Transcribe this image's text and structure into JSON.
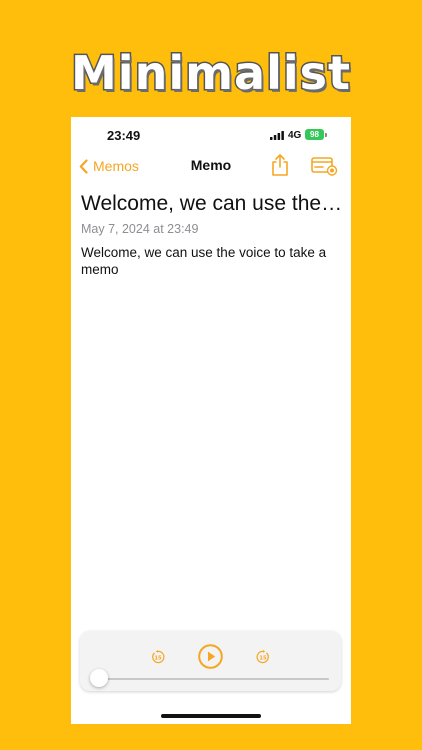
{
  "promo": {
    "title": "Minimalist"
  },
  "status_bar": {
    "time": "23:49",
    "network": "4G",
    "battery": "98",
    "battery_color": "#34C759"
  },
  "nav": {
    "back_label": "Memos",
    "title": "Memo",
    "accent_color": "#F5A623",
    "icons": [
      "chevron-left-icon",
      "share-icon",
      "reader-mode-icon"
    ]
  },
  "memo": {
    "title": "Welcome, we can use the voice to take a memo",
    "date": "May 7, 2024 at 23:49",
    "body": "Welcome, we can use the voice to take a memo"
  },
  "player": {
    "skip_back_seconds": "15",
    "skip_forward_seconds": "15",
    "progress": 0,
    "icons": [
      "skip-back-15-icon",
      "play-icon",
      "skip-forward-15-icon"
    ]
  }
}
